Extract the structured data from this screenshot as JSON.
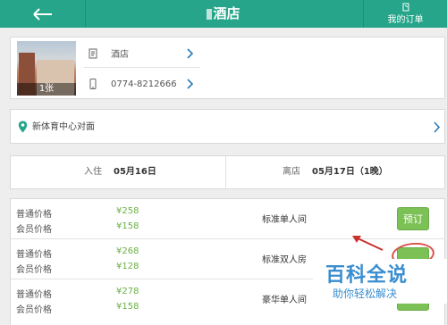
{
  "header": {
    "title": "酒店",
    "orders_label": "我的订单"
  },
  "hotel": {
    "photo_count": "1张",
    "name": "酒店",
    "phone": "0774-8212666"
  },
  "address": "新体育中心对面",
  "dates": {
    "checkin_label": "入住",
    "checkin_value": "05月16日",
    "checkout_label": "离店",
    "checkout_value": "05月17日（1晚）"
  },
  "rooms": [
    {
      "regular_label": "普通价格",
      "regular_price": "¥258",
      "member_label": "会员价格",
      "member_price": "¥158",
      "name": "标准单人间",
      "button": "预订"
    },
    {
      "regular_label": "普通价格",
      "regular_price": "¥268",
      "member_label": "会员价格",
      "member_price": "¥128",
      "name": "标准双人房",
      "button": ""
    },
    {
      "regular_label": "普通价格",
      "regular_price": "¥278",
      "member_label": "会员价格",
      "member_price": "¥158",
      "name": "豪华单人间",
      "button": ""
    }
  ],
  "watermark": {
    "main": "百科全说",
    "sub": "助你轻松解决"
  },
  "colors": {
    "header_bg": "#26a58a",
    "accent_green": "#7cc156",
    "price_green": "#6bb044",
    "watermark_blue": "#3a8ecf"
  },
  "icons": [
    "back-arrow-icon",
    "orders-icon",
    "document-icon",
    "phone-icon",
    "chevron-right-icon",
    "location-pin-icon"
  ]
}
